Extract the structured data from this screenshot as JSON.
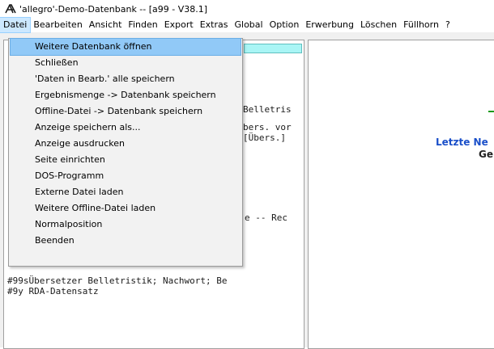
{
  "window": {
    "title": "'allegro'-Demo-Datenbank -- [a99 - V38.1]",
    "icon": "allegro-logo-icon"
  },
  "menubar": {
    "items": [
      "Datei",
      "Bearbeiten",
      "Ansicht",
      "Finden",
      "Export",
      "Extras",
      "Global",
      "Option",
      "Erwerbung",
      "Löschen",
      "Füllhorn",
      "?"
    ],
    "active_index": 0
  },
  "dropdown": {
    "items": [
      "Weitere Datenbank öffnen",
      "Schließen",
      "'Daten in Bearb.' alle speichern",
      "Ergebnismenge -> Datenbank speichern",
      "Offline-Datei -> Datenbank speichern",
      "Anzeige speichern als...",
      "Anzeige ausdrucken",
      "Seite einrichten",
      "DOS-Programm",
      "Externe Datei laden",
      "Weitere Offline-Datei laden",
      "Normalposition",
      "Beenden"
    ],
    "highlighted_index": 0
  },
  "left_pane": {
    "visible_fragments": [
      "Belletris",
      "bers. vor",
      "[Übers.]",
      "e -- Rec",
      "#99sÜbersetzer Belletristik; Nachwort; Be",
      "#9y RDA-Datensatz"
    ]
  },
  "right_pane": {
    "heading": "Letzte Ne",
    "subheading": "Ge"
  },
  "colors": {
    "highlight": "#91c9f7",
    "heading_blue": "#1a4fc9",
    "strip_cyan": "#a9f5f5"
  }
}
